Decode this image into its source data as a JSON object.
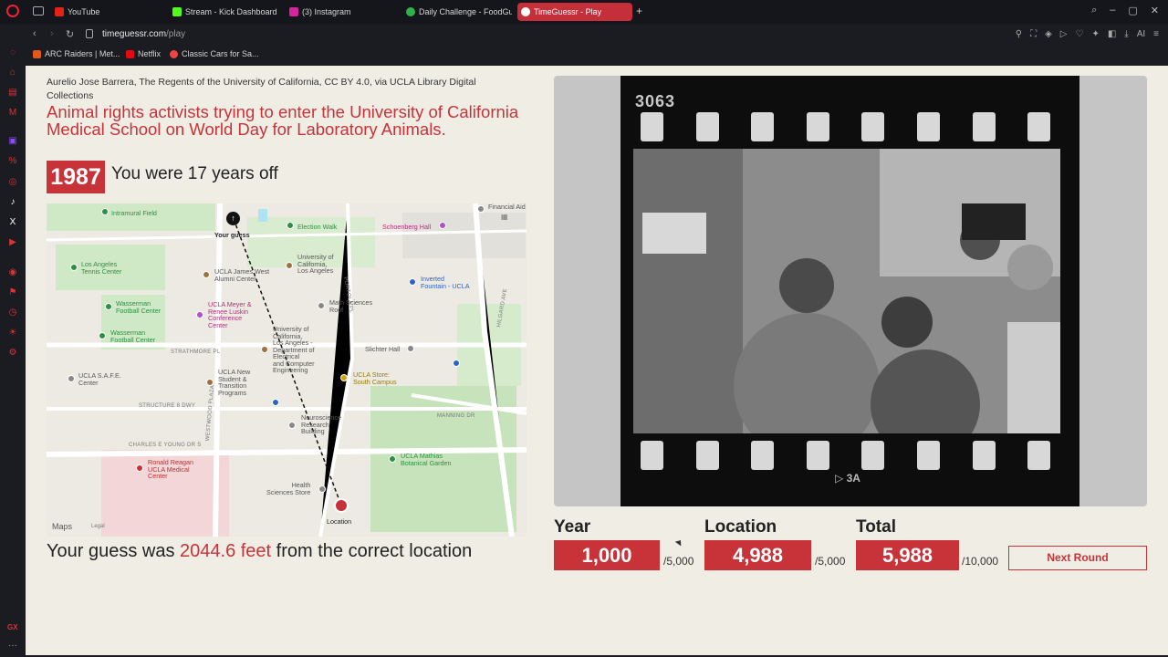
{
  "browser": {
    "tabs": [
      {
        "label": "YouTube",
        "color": "#e62117"
      },
      {
        "label": "Stream - Kick Dashboard",
        "color": "#53fc18"
      },
      {
        "label": "(3) Instagram",
        "color": "#d6249f"
      },
      {
        "label": "Daily Challenge - FoodGus",
        "color": "#2db34a"
      },
      {
        "label": "TimeGuessr - Play",
        "color": "#c83339"
      }
    ],
    "url_domain": "timeguessr.com",
    "url_path": "/play",
    "bookmarks": [
      {
        "label": "ARC Raiders | Met...",
        "color": "#e05a1e"
      },
      {
        "label": "Netflix",
        "color": "#e50914"
      },
      {
        "label": "Classic Cars for Sa...",
        "color": "#e44"
      }
    ]
  },
  "result": {
    "credit": "Aurelio Jose Barrera, The Regents of the University of California, CC BY 4.0, via UCLA Library Digital Collections",
    "title": "Animal rights activists trying to enter the University of California Medical School on World Day for Laboratory Animals.",
    "correct_year": "1987",
    "years_off_text": "You were 17 years off",
    "distance_prefix": "Your guess was ",
    "distance_value": "2044.6 feet",
    "distance_suffix": " from the correct location"
  },
  "map": {
    "your_guess_label": "Your guess",
    "location_label": "Location",
    "attribution": "Maps",
    "legal": "Legal",
    "labels": {
      "intramural": "Intramural Field",
      "election_walk": "Election Walk",
      "schoenberg": "Schoenberg Hall",
      "financial_aid": "Financial Aid",
      "la_tennis": "Los Angeles\nTennis Center",
      "uc_la": "University of\nCalifornia,\nLos Angeles",
      "ucla_james_west": "UCLA James West\nAlumni Center",
      "inverted_fountain": "Inverted\nFountain - UCLA",
      "wasserman1": "Wasserman\nFootball Center",
      "wasserman2": "Wasserman\nFootball Center",
      "meyer_luskin": "UCLA Meyer &\nRenee Luskin\nConference\nCenter",
      "math_sciences": "Math Sciences\nRoof",
      "ece": "University of\nCalifornia,\nLos Angeles -\nDepartment of\nElectrical\nand Computer\nEngineering",
      "strathmore": "STRATHMORE PL",
      "slichter": "Slichter Hall",
      "ucla_safe": "UCLA S.A.F.E.\nCenter",
      "ucla_new_student": "UCLA New\nStudent &\nTransition\nPrograms",
      "ucla_store": "UCLA Store:\nSouth Campus",
      "structure8": "STRUCTURE 8 DWY",
      "neuroscience": "Neuroscience\nResearch\nBuilding",
      "manning": "MANNING DR",
      "charles_young": "CHARLES E YOUNG DR S",
      "mathias": "UCLA Mathias\nBotanical Garden",
      "reagan": "Ronald Reagan\nUCLA Medical\nCenter",
      "health_sciences": "Health\nSciences Store",
      "westwood": "WESTWOOD PLAZA",
      "portola": "PORTOLA PL",
      "hilgard": "HILGARD AVE"
    }
  },
  "photo": {
    "film_number": "3063",
    "frame_code": "3A"
  },
  "scores": {
    "year_label": "Year",
    "year_value": "1,000",
    "year_max": "/5,000",
    "location_label": "Location",
    "location_value": "4,988",
    "location_max": "/5,000",
    "total_label": "Total",
    "total_value": "5,988",
    "total_max": "/10,000",
    "next_button": "Next Round"
  }
}
